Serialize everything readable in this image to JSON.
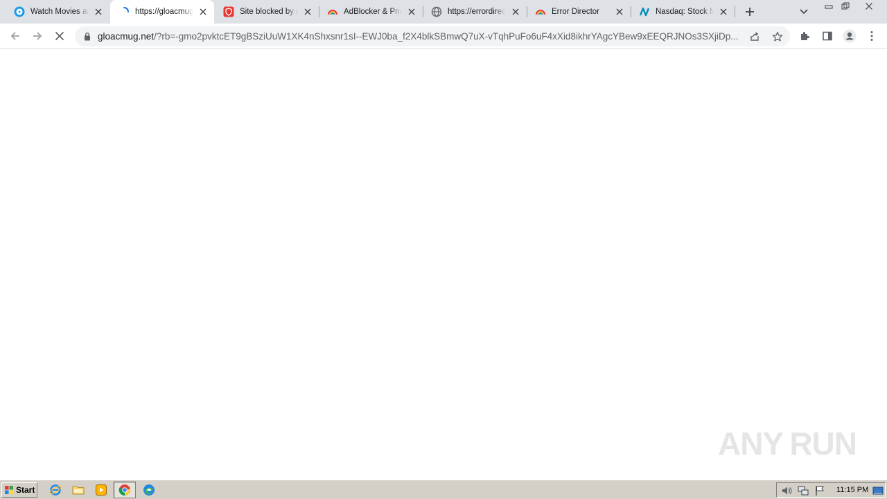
{
  "tabs": [
    {
      "title": "Watch Movies and TV Shows",
      "icon": "play-circle-icon",
      "active": false
    },
    {
      "title": "https://gloacmug.net",
      "icon": "loading-spinner-icon",
      "active": true
    },
    {
      "title": "Site blocked by AdBlocker",
      "icon": "shield-icon",
      "active": false
    },
    {
      "title": "AdBlocker & Privacy",
      "icon": "rainbow-icon",
      "active": false
    },
    {
      "title": "https://errordirector",
      "icon": "globe-icon",
      "active": false
    },
    {
      "title": "Error Director",
      "icon": "rainbow-icon",
      "active": false
    },
    {
      "title": "Nasdaq: Stock Market",
      "icon": "nasdaq-icon",
      "active": false
    }
  ],
  "address_bar": {
    "host": "gloacmug.net",
    "path": "/?rb=-gmo2pvktcET9gBSziUuW1XK4nShxsnr1sI--EWJ0ba_f2X4blkSBmwQ7uX-vTqhPuFo6uF4xXid8ikhrYAgcYBew9xEEQRJNOs3SXjiDp..."
  },
  "taskbar": {
    "start_label": "Start",
    "clock": "11:15 PM"
  },
  "watermark": {
    "left": "ANY",
    "right": "RUN"
  },
  "colors": {
    "tabstrip": "#dee1e6",
    "omnibox": "#f1f3f4",
    "taskbar": "#d4d0c8"
  }
}
